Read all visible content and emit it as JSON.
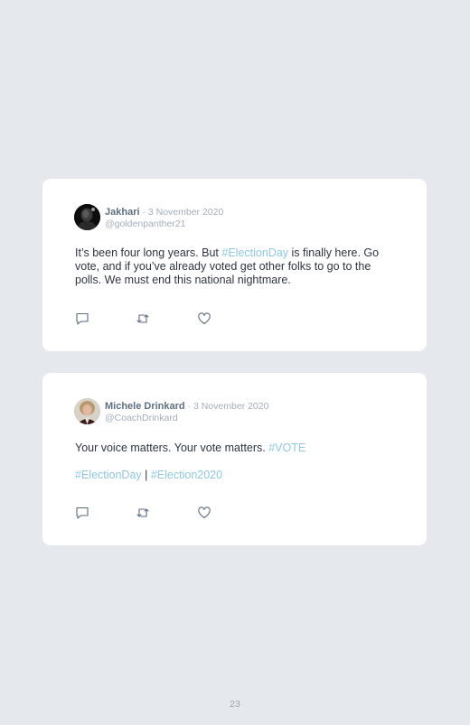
{
  "tweets": [
    {
      "name": "Jakhari",
      "meta": " · 3 November 2020",
      "handle": "@goldenpanther21",
      "paragraphs": [
        [
          {
            "t": "It’s been four long years. But ",
            "tag": false
          },
          {
            "t": "#ElectionDay",
            "tag": true
          },
          {
            "t": " is finally here. Go vote, and if you’ve already voted get other folks to go to the polls. We must end this national nightmare.",
            "tag": false
          }
        ]
      ],
      "icons": [
        "reply-icon",
        "retweet-icon",
        "like-icon"
      ]
    },
    {
      "name": "Michele Drinkard",
      "meta": " · 3 November 2020",
      "handle": "@CoachDrinkard",
      "paragraphs": [
        [
          {
            "t": "Your voice matters. Your vote matters. ",
            "tag": false
          },
          {
            "t": "#VOTE",
            "tag": true
          }
        ],
        [
          {
            "t": "#ElectionDay",
            "tag": true
          },
          {
            "t": " | ",
            "tag": false
          },
          {
            "t": "#Election2020",
            "tag": true
          }
        ]
      ],
      "icons": [
        "reply-icon",
        "retweet-icon",
        "like-icon"
      ]
    }
  ],
  "page_number": "23",
  "colors": {
    "background": "#e5e8ed",
    "card": "#ffffff",
    "hashtag": "#8ec7e3",
    "name": "#5f6f80",
    "meta": "#a4aeba",
    "text": "#2f3440",
    "icon": "#5c6a7d"
  }
}
